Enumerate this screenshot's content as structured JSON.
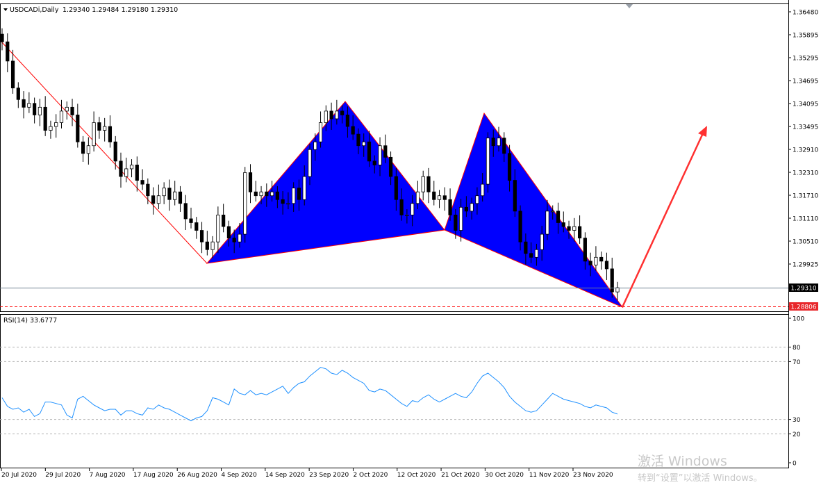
{
  "header": {
    "symbol": "USDCADi,Daily",
    "ohlc": "1.29340 1.29484 1.29180 1.29310"
  },
  "indicator_label": "RSI(14) 33.6777",
  "price_labels": [
    "1.36480",
    "1.35895",
    "1.35295",
    "1.34695",
    "1.34095",
    "1.33495",
    "1.32910",
    "1.32310",
    "1.31710",
    "1.31110",
    "1.30510",
    "1.29925",
    "1.29310",
    "1.28806"
  ],
  "current_price": "1.29310",
  "target_price": "1.28806",
  "rsi_levels": [
    "100",
    "80",
    "70",
    "30",
    "20",
    "0"
  ],
  "date_labels": [
    "20 Jul 2020",
    "29 Jul 2020",
    "7 Aug 2020",
    "17 Aug 2020",
    "26 Aug 2020",
    "4 Sep 2020",
    "14 Sep 2020",
    "23 Sep 2020",
    "2 Oct 2020",
    "12 Oct 2020",
    "21 Oct 2020",
    "30 Oct 2020",
    "11 Nov 2020",
    "23 Nov 2020"
  ],
  "watermark": {
    "line1": "激活 Windows",
    "line2": "转到“设置”以激活 Windows。"
  },
  "colors": {
    "bull": "#ffffff",
    "bear": "#000000",
    "pattern_fill": "#0000ff",
    "pattern_edge": "#ff0000",
    "rsi_line": "#1e90ff",
    "arrow": "#ff3030",
    "target_line": "#ff0000",
    "current_line": "#708090"
  },
  "chart_data": [
    {
      "type": "candlestick",
      "symbol": "USDCAD",
      "timeframe": "Daily",
      "ylim": [
        1.2855,
        1.3648
      ],
      "x_range": [
        "20 Jul 2020",
        "30 Nov 2020"
      ],
      "candles_close": [
        1.357,
        1.352,
        1.345,
        1.342,
        1.34,
        1.341,
        1.338,
        1.34,
        1.334,
        1.335,
        1.336,
        1.339,
        1.34,
        1.338,
        1.331,
        1.328,
        1.33,
        1.336,
        1.334,
        1.335,
        1.331,
        1.326,
        1.322,
        1.324,
        1.325,
        1.321,
        1.32,
        1.317,
        1.315,
        1.317,
        1.319,
        1.316,
        1.318,
        1.315,
        1.311,
        1.31,
        1.308,
        1.305,
        1.303,
        1.305,
        1.312,
        1.309,
        1.306,
        1.305,
        1.307,
        1.323,
        1.318,
        1.317,
        1.318,
        1.317,
        1.318,
        1.316,
        1.315,
        1.315,
        1.319,
        1.316,
        1.322,
        1.329,
        1.331,
        1.336,
        1.339,
        1.337,
        1.339,
        1.338,
        1.335,
        1.333,
        1.33,
        1.331,
        1.326,
        1.325,
        1.33,
        1.327,
        1.322,
        1.316,
        1.312,
        1.312,
        1.315,
        1.318,
        1.322,
        1.318,
        1.316,
        1.317,
        1.316,
        1.312,
        1.308,
        1.314,
        1.313,
        1.315,
        1.317,
        1.32,
        1.332,
        1.33,
        1.332,
        1.328,
        1.321,
        1.313,
        1.305,
        1.302,
        1.301,
        1.303,
        1.307,
        1.313,
        1.313,
        1.31,
        1.309,
        1.308,
        1.309,
        1.306,
        1.3,
        1.299,
        1.301,
        1.3,
        1.298,
        1.292,
        1.2931
      ],
      "reference_lines": [
        {
          "label": "current price",
          "value": 1.2931
        },
        {
          "label": "target",
          "value": 1.28806
        }
      ]
    },
    {
      "type": "line",
      "name": "RSI(14)",
      "last_value": 33.6777,
      "ylim": [
        0,
        100
      ],
      "levels": [
        30,
        70,
        80
      ],
      "values": [
        45,
        39,
        37,
        38,
        35,
        37,
        32,
        34,
        42,
        42,
        41,
        40,
        33,
        31,
        44,
        46,
        43,
        40,
        38,
        36,
        37,
        37,
        33,
        36,
        36,
        34,
        33,
        38,
        37,
        40,
        38,
        37,
        35,
        33,
        31,
        29,
        31,
        32,
        36,
        45,
        44,
        42,
        40,
        51,
        48,
        47,
        50,
        47,
        48,
        47,
        49,
        51,
        53,
        48,
        52,
        55,
        56,
        60,
        63,
        66,
        65,
        62,
        61,
        64,
        62,
        59,
        57,
        55,
        50,
        49,
        51,
        50,
        47,
        44,
        41,
        39,
        43,
        42,
        45,
        47,
        44,
        42,
        44,
        46,
        48,
        46,
        45,
        49,
        55,
        60,
        62,
        59,
        56,
        52,
        46,
        42,
        39,
        36,
        35,
        36,
        40,
        44,
        48,
        46,
        44,
        43,
        42,
        41,
        39,
        38,
        40,
        39,
        38,
        35,
        33.68
      ]
    }
  ]
}
